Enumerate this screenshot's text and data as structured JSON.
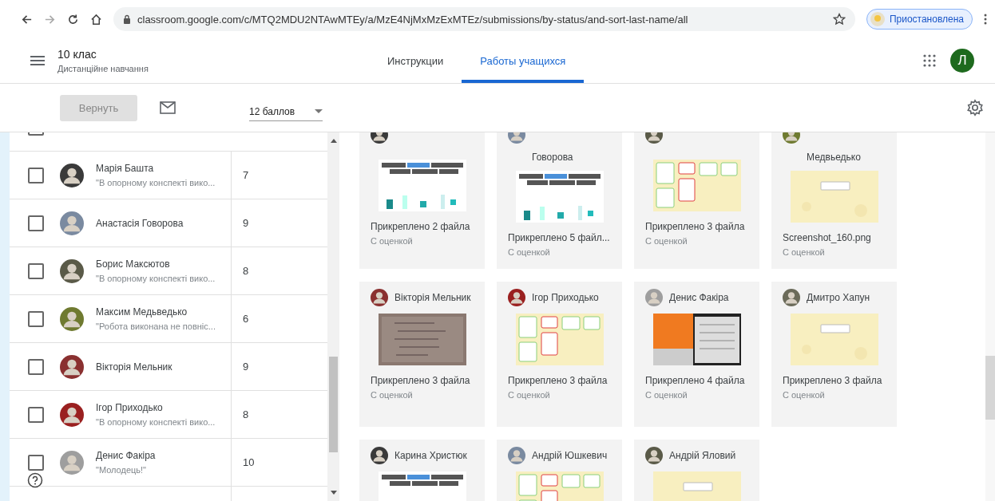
{
  "browser": {
    "url": "classroom.google.com/c/MTQ2MDU2NTAwMTEy/a/MzE4NjMxMzExMTEz/submissions/by-status/and-sort-last-name/all",
    "profile": "Приостановлена"
  },
  "header": {
    "title": "10 клас",
    "subtitle": "Дистанційне навчання",
    "avatar_letter": "Л"
  },
  "tabs": [
    {
      "label": "Инструкции",
      "selected": false
    },
    {
      "label": "Работы учащихся",
      "selected": true
    }
  ],
  "toolbar": {
    "return_button": {
      "label": "Вернуть",
      "disabled": true
    },
    "points": "12 баллов"
  },
  "students": [
    {
      "checked": false
    },
    {
      "name": "Марія Башта",
      "comment": "\"В опорному конспекті вико...",
      "grade": "7",
      "checked": false
    },
    {
      "name": "Анастасія Говорова",
      "grade": "9",
      "checked": false
    },
    {
      "name": "Борис Максютов",
      "comment": "\"В опорному конспекті вико...",
      "grade": "8",
      "checked": false
    },
    {
      "name": "Максим Медьведько",
      "comment": "\"Робота виконана не повніс...",
      "grade": "6",
      "checked": false
    },
    {
      "name": "Вікторія Мельник",
      "grade": "9",
      "checked": false
    },
    {
      "name": "Ігор Приходько",
      "comment": "\"В опорному конспекті вико...",
      "grade": "8",
      "checked": false
    },
    {
      "name": "Денис Факіра",
      "comment": "\"Молодець!\"",
      "grade": "10",
      "checked": false
    }
  ],
  "cards": [
    {
      "files": "Прикреплено 2 файла",
      "status": "С оценкой"
    },
    {
      "name": "Говорова",
      "files": "Прикреплено 5 файл...",
      "status": "С оценкой"
    },
    {
      "files": "Прикреплено 3 файла",
      "status": "С оценкой"
    },
    {
      "name": "Медвьедько",
      "files": "Screenshot_160.png",
      "status": "С оценкой"
    },
    {
      "name": "Вікторія Мельник",
      "files": "Прикреплено 3 файла",
      "status": "С оценкой"
    },
    {
      "name": "Ігор Приходько",
      "files": "Прикреплено 3 файла",
      "status": "С оценкой"
    },
    {
      "name": "Денис Факіра",
      "files": "Прикреплено 4 файла",
      "status": "С оценкой"
    },
    {
      "name": "Дмитро Хапун",
      "files": "Прикреплено 3 файла",
      "status": "С оценкой"
    },
    {
      "name": "Карина Христюк"
    },
    {
      "name": "Андрій Юшкевич"
    },
    {
      "name": "Андрій Яловий"
    }
  ]
}
